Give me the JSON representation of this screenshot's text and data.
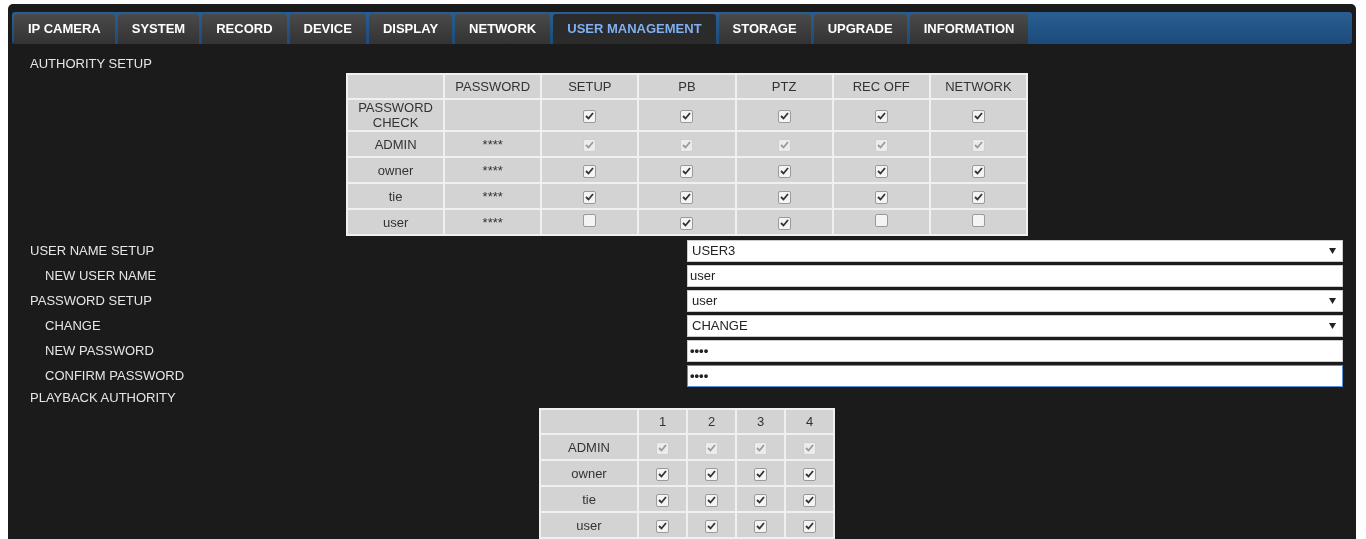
{
  "tabs": [
    {
      "label": "IP CAMERA",
      "selected": false
    },
    {
      "label": "SYSTEM",
      "selected": false
    },
    {
      "label": "RECORD",
      "selected": false
    },
    {
      "label": "DEVICE",
      "selected": false
    },
    {
      "label": "DISPLAY",
      "selected": false
    },
    {
      "label": "NETWORK",
      "selected": false
    },
    {
      "label": "USER MANAGEMENT",
      "selected": true
    },
    {
      "label": "STORAGE",
      "selected": false
    },
    {
      "label": "UPGRADE",
      "selected": false
    },
    {
      "label": "INFORMATION",
      "selected": false
    }
  ],
  "authority_setup": {
    "title": "AUTHORITY SETUP",
    "columns": [
      "PASSWORD",
      "SETUP",
      "PB",
      "PTZ",
      "REC OFF",
      "NETWORK"
    ],
    "rows": [
      {
        "label": "PASSWORD CHECK",
        "permissions": [
          {
            "checked": true,
            "disabled": false
          },
          {
            "checked": true,
            "disabled": false
          },
          {
            "checked": true,
            "disabled": false
          },
          {
            "checked": true,
            "disabled": false
          },
          {
            "checked": true,
            "disabled": false
          }
        ]
      },
      {
        "label": "ADMIN",
        "password": "****",
        "permissions": [
          {
            "checked": true,
            "disabled": true
          },
          {
            "checked": true,
            "disabled": true
          },
          {
            "checked": true,
            "disabled": true
          },
          {
            "checked": true,
            "disabled": true
          },
          {
            "checked": true,
            "disabled": true
          }
        ]
      },
      {
        "label": "owner",
        "password": "****",
        "permissions": [
          {
            "checked": true,
            "disabled": false
          },
          {
            "checked": true,
            "disabled": false
          },
          {
            "checked": true,
            "disabled": false
          },
          {
            "checked": true,
            "disabled": false
          },
          {
            "checked": true,
            "disabled": false
          }
        ]
      },
      {
        "label": "tie",
        "password": "****",
        "permissions": [
          {
            "checked": true,
            "disabled": false
          },
          {
            "checked": true,
            "disabled": false
          },
          {
            "checked": true,
            "disabled": false
          },
          {
            "checked": true,
            "disabled": false
          },
          {
            "checked": true,
            "disabled": false
          }
        ]
      },
      {
        "label": "user",
        "password": "****",
        "permissions": [
          {
            "checked": false,
            "disabled": false
          },
          {
            "checked": true,
            "disabled": false
          },
          {
            "checked": true,
            "disabled": false
          },
          {
            "checked": false,
            "disabled": false
          },
          {
            "checked": false,
            "disabled": false
          }
        ]
      }
    ]
  },
  "fields": [
    {
      "label": "USER NAME SETUP",
      "indented": false,
      "kind": "select",
      "value": "USER3",
      "focused": false
    },
    {
      "label": "NEW USER NAME",
      "indented": true,
      "kind": "text",
      "value": "user",
      "focused": false
    },
    {
      "label": "PASSWORD SETUP",
      "indented": false,
      "kind": "select",
      "value": "user",
      "focused": false
    },
    {
      "label": "CHANGE",
      "indented": true,
      "kind": "select",
      "value": "CHANGE",
      "focused": false
    },
    {
      "label": "NEW PASSWORD",
      "indented": true,
      "kind": "password",
      "value": "••••",
      "focused": false
    },
    {
      "label": "CONFIRM PASSWORD",
      "indented": true,
      "kind": "password",
      "value": "••••",
      "focused": true
    }
  ],
  "playback_authority": {
    "title": "PLAYBACK AUTHORITY",
    "columns": [
      "1",
      "2",
      "3",
      "4"
    ],
    "rows": [
      {
        "label": "ADMIN",
        "channels": [
          {
            "checked": true,
            "disabled": true
          },
          {
            "checked": true,
            "disabled": true
          },
          {
            "checked": true,
            "disabled": true
          },
          {
            "checked": true,
            "disabled": true
          }
        ]
      },
      {
        "label": "owner",
        "channels": [
          {
            "checked": true,
            "disabled": false
          },
          {
            "checked": true,
            "disabled": false
          },
          {
            "checked": true,
            "disabled": false
          },
          {
            "checked": true,
            "disabled": false
          }
        ]
      },
      {
        "label": "tie",
        "channels": [
          {
            "checked": true,
            "disabled": false
          },
          {
            "checked": true,
            "disabled": false
          },
          {
            "checked": true,
            "disabled": false
          },
          {
            "checked": true,
            "disabled": false
          }
        ]
      },
      {
        "label": "user",
        "channels": [
          {
            "checked": true,
            "disabled": false
          },
          {
            "checked": true,
            "disabled": false
          },
          {
            "checked": true,
            "disabled": false
          },
          {
            "checked": true,
            "disabled": false
          }
        ]
      }
    ]
  }
}
